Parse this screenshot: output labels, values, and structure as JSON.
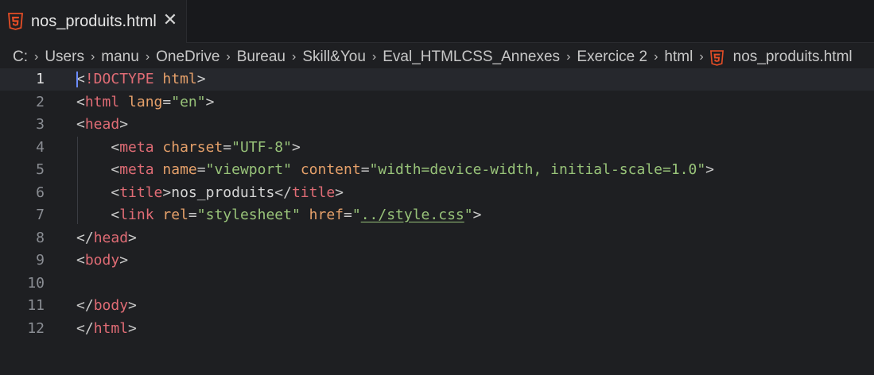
{
  "tab": {
    "label": "nos_produits.html",
    "close": "✕"
  },
  "breadcrumb": [
    "C:",
    "Users",
    "manu",
    "OneDrive",
    "Bureau",
    "Skill&You",
    "Eval_HTMLCSS_Annexes",
    "Exercice 2",
    "html",
    "nos_produits.html"
  ],
  "breadcrumb_sep": "›",
  "editor": {
    "active_line": 1,
    "lines": [
      {
        "n": "1",
        "tokens": [
          [
            "punc",
            "<"
          ],
          [
            "tag",
            "!DOCTYPE"
          ],
          [
            "txt",
            " "
          ],
          [
            "attr",
            "html"
          ],
          [
            "punc",
            ">"
          ]
        ]
      },
      {
        "n": "2",
        "tokens": [
          [
            "punc",
            "<"
          ],
          [
            "tag",
            "html"
          ],
          [
            "txt",
            " "
          ],
          [
            "attr",
            "lang"
          ],
          [
            "punc",
            "="
          ],
          [
            "str",
            "\"en\""
          ],
          [
            "punc",
            ">"
          ]
        ]
      },
      {
        "n": "3",
        "tokens": [
          [
            "punc",
            "<"
          ],
          [
            "tag",
            "head"
          ],
          [
            "punc",
            ">"
          ]
        ]
      },
      {
        "n": "4",
        "tokens": [
          [
            "txt",
            "    "
          ],
          [
            "punc",
            "<"
          ],
          [
            "tag",
            "meta"
          ],
          [
            "txt",
            " "
          ],
          [
            "attr",
            "charset"
          ],
          [
            "punc",
            "="
          ],
          [
            "str",
            "\"UTF-8\""
          ],
          [
            "punc",
            ">"
          ]
        ]
      },
      {
        "n": "5",
        "tokens": [
          [
            "txt",
            "    "
          ],
          [
            "punc",
            "<"
          ],
          [
            "tag",
            "meta"
          ],
          [
            "txt",
            " "
          ],
          [
            "attr",
            "name"
          ],
          [
            "punc",
            "="
          ],
          [
            "str",
            "\"viewport\""
          ],
          [
            "txt",
            " "
          ],
          [
            "attr",
            "content"
          ],
          [
            "punc",
            "="
          ],
          [
            "str",
            "\"width=device-width, initial-scale=1.0\""
          ],
          [
            "punc",
            ">"
          ]
        ]
      },
      {
        "n": "6",
        "tokens": [
          [
            "txt",
            "    "
          ],
          [
            "punc",
            "<"
          ],
          [
            "tag",
            "title"
          ],
          [
            "punc",
            ">"
          ],
          [
            "txt",
            "nos_produits"
          ],
          [
            "punc",
            "</"
          ],
          [
            "tag",
            "title"
          ],
          [
            "punc",
            ">"
          ]
        ]
      },
      {
        "n": "7",
        "tokens": [
          [
            "txt",
            "    "
          ],
          [
            "punc",
            "<"
          ],
          [
            "tag",
            "link"
          ],
          [
            "txt",
            " "
          ],
          [
            "attr",
            "rel"
          ],
          [
            "punc",
            "="
          ],
          [
            "str",
            "\"stylesheet\""
          ],
          [
            "txt",
            " "
          ],
          [
            "attr",
            "href"
          ],
          [
            "punc",
            "="
          ],
          [
            "str",
            "\""
          ],
          [
            "link",
            "../style.css"
          ],
          [
            "str",
            "\""
          ],
          [
            "punc",
            ">"
          ]
        ]
      },
      {
        "n": "8",
        "tokens": [
          [
            "punc",
            "</"
          ],
          [
            "tag",
            "head"
          ],
          [
            "punc",
            ">"
          ]
        ]
      },
      {
        "n": "9",
        "tokens": [
          [
            "punc",
            "<"
          ],
          [
            "tag",
            "body"
          ],
          [
            "punc",
            ">"
          ]
        ]
      },
      {
        "n": "10",
        "tokens": []
      },
      {
        "n": "11",
        "tokens": [
          [
            "punc",
            "</"
          ],
          [
            "tag",
            "body"
          ],
          [
            "punc",
            ">"
          ]
        ]
      },
      {
        "n": "12",
        "tokens": [
          [
            "punc",
            "</"
          ],
          [
            "tag",
            "html"
          ],
          [
            "punc",
            ">"
          ]
        ]
      }
    ]
  },
  "colors": {
    "tag": "#e06c75",
    "attr": "#e5a06a",
    "string": "#98c379",
    "html5_badge": "#e44d26"
  }
}
